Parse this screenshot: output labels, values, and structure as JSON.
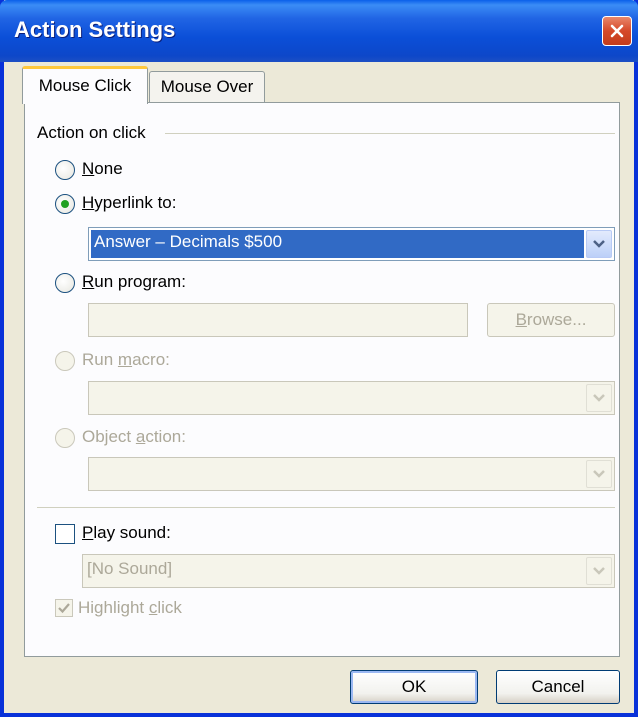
{
  "window": {
    "title": "Action Settings"
  },
  "tabs": [
    {
      "label": "Mouse Click",
      "active": true
    },
    {
      "label": "Mouse Over",
      "active": false
    }
  ],
  "group": {
    "label": "Action on click"
  },
  "options": {
    "none": {
      "label": "None",
      "mnemonic": "N",
      "rest": "one",
      "checked": false,
      "enabled": true
    },
    "hyperlink": {
      "label": "Hyperlink to:",
      "mnemonic": "H",
      "rest": "yperlink to:",
      "checked": true,
      "enabled": true
    },
    "run_program": {
      "label": "Run program:",
      "mnemonic": "R",
      "rest": "un program:",
      "checked": false,
      "enabled": true
    },
    "run_macro": {
      "label": "Run macro:",
      "pre": "Run ",
      "mnemonic": "m",
      "rest": "acro:",
      "checked": false,
      "enabled": false
    },
    "object_action": {
      "label": "Object action:",
      "pre": "Object ",
      "mnemonic": "a",
      "rest": "ction:",
      "checked": false,
      "enabled": false
    }
  },
  "hyperlink_select": {
    "value": "Answer – Decimals $500",
    "selected_bg": "#316ac5"
  },
  "run_program_input": {
    "value": ""
  },
  "browse_button": {
    "pre": "",
    "mnemonic": "B",
    "rest": "rowse...",
    "label": "Browse...",
    "enabled": false
  },
  "macro_select": {
    "value": ""
  },
  "object_select": {
    "value": ""
  },
  "play_sound": {
    "label": "Play sound:",
    "mnemonic": "P",
    "rest": "lay sound:",
    "checked": false,
    "enabled": true
  },
  "sound_select": {
    "value": "[No Sound]",
    "enabled": false
  },
  "highlight_click": {
    "label": "Highlight click",
    "pre": "Highlight ",
    "mnemonic": "c",
    "rest": "lick",
    "checked": true,
    "enabled": false
  },
  "buttons": {
    "ok": "OK",
    "cancel": "Cancel"
  },
  "colors": {
    "titlebar": "#0b4fd8",
    "dialog_bg": "#ece9d8",
    "radio_dot": "#21a121",
    "tab_highlight": "#ffc83c",
    "disabled_text": "#aca899"
  }
}
